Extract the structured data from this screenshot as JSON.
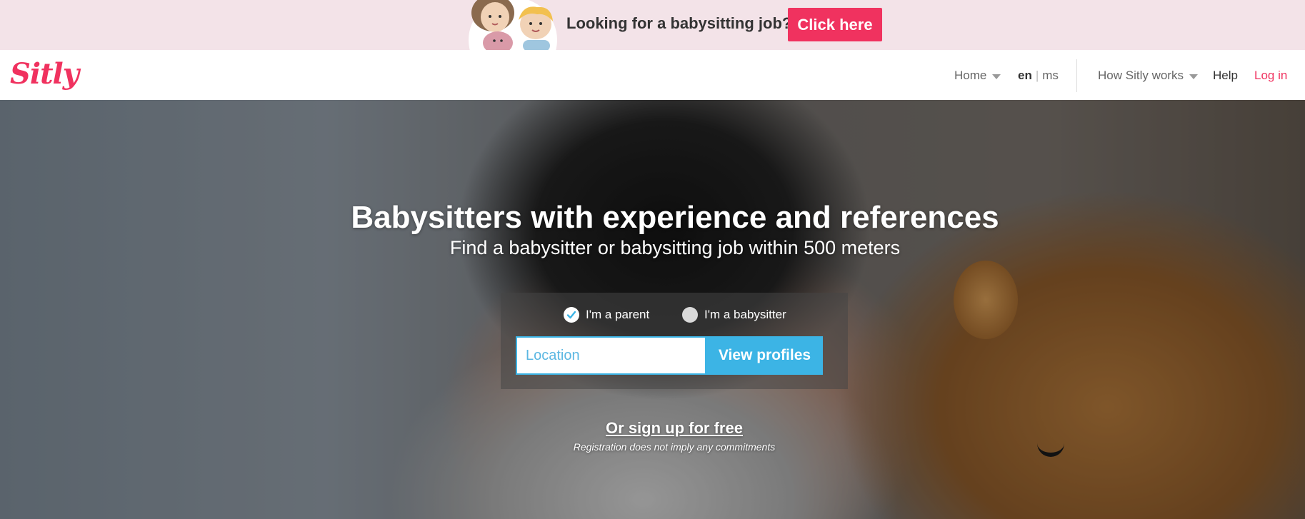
{
  "promo": {
    "text": "Looking for a babysitting job?",
    "button_label": "Click here",
    "illustration_icon": "parent-and-children-illustration"
  },
  "nav": {
    "logo": "Sitly",
    "home_label": "Home",
    "lang_en": "en",
    "lang_separator": "|",
    "lang_ms": "ms",
    "how_label": "How Sitly works",
    "help_label": "Help",
    "login_label": "Log in"
  },
  "hero": {
    "title": "Babysitters with experience and references",
    "subtitle": "Find a babysitter or babysitting job within 500 meters",
    "role_options": [
      {
        "label": "I'm a parent",
        "selected": true
      },
      {
        "label": "I'm a babysitter",
        "selected": false
      }
    ],
    "location_placeholder": "Location",
    "location_value": "",
    "view_button_label": "View profiles",
    "signup_label": "Or sign up for free",
    "signup_note": "Registration does not imply any commitments"
  },
  "colors": {
    "brand_pink": "#f0325f",
    "accent_blue": "#3cb4e5",
    "promo_bg": "#f3e3e8"
  }
}
